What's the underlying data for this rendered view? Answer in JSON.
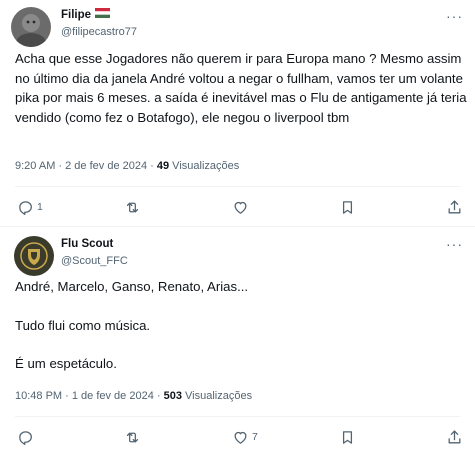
{
  "post1": {
    "display_name": "Filipe",
    "flag_icon": "hungary-flag-icon",
    "handle": "@filipecastro77",
    "more_label": "···",
    "text": "Acha que esse Jogadores não querem ir para Europa mano ? Mesmo assim no último dia da janela André voltou a negar o fullham, vamos ter um volante pika por mais 6 meses. a saída é inevitável mas o Flu de antigamente já teria vendido (como fez o Botafogo), ele negou o liverpool tbm",
    "time_date": "9:20 AM · 2 de fev de 2024 · ",
    "views_count": "49",
    "views_label": " Visualizações",
    "actions": {
      "reply_count": "1",
      "retweet_count": "",
      "like_count": "",
      "icons": [
        "reply-icon",
        "retweet-icon",
        "like-icon",
        "bookmark-icon",
        "share-icon"
      ]
    }
  },
  "post2": {
    "display_name": "Flu Scout",
    "handle": "@Scout_FFC",
    "more_label": "···",
    "paragraphs": [
      "André, Marcelo, Ganso, Renato, Arias...",
      "Tudo flui como música.",
      "É um espetáculo."
    ],
    "time_date": "10:48 PM · 1 de fev de 2024 · ",
    "views_count": "503",
    "views_label": " Visualizações",
    "actions": {
      "reply_count": "",
      "retweet_count": "",
      "like_count": "7",
      "icons": [
        "reply-icon",
        "retweet-icon",
        "like-icon",
        "bookmark-icon",
        "share-icon"
      ]
    }
  },
  "colors": {
    "text_primary": "#0f1419",
    "text_secondary": "#536471",
    "divider": "#eff3f4"
  }
}
